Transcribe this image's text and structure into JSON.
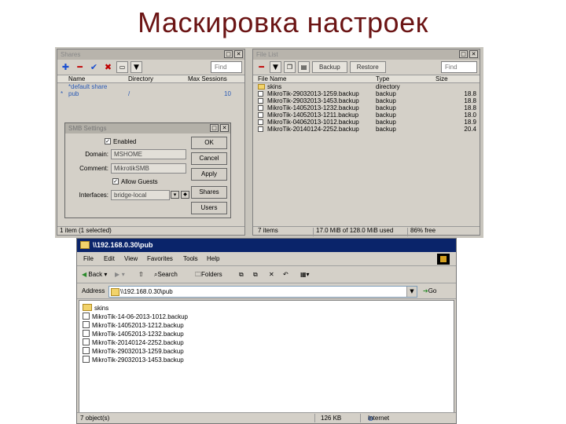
{
  "slide_title": "Маскировка настроек",
  "share_panel": {
    "title": "Shares",
    "find": "Find",
    "columns": [
      "Name",
      "Directory",
      "Max Sessions"
    ],
    "rows": [
      {
        "name": "*default share",
        "directory": "",
        "max_sessions": ""
      },
      {
        "name": "pub",
        "directory": "/",
        "max_sessions": "10"
      }
    ],
    "status": "1 item (1 selected)"
  },
  "smb_dialog": {
    "title": "SMB Settings",
    "enabled_label": "Enabled",
    "domain_label": "Domain:",
    "domain_value": "MSHOME",
    "comment_label": "Comment:",
    "comment_value": "MikrotikSMB",
    "allow_guests_label": "Allow Guests",
    "interfaces_label": "Interfaces:",
    "interfaces_value": "bridge-local",
    "buttons": [
      "OK",
      "Cancel",
      "Apply",
      "Shares",
      "Users"
    ]
  },
  "file_panel": {
    "title": "File List",
    "backup_button": "Backup",
    "restore_button": "Restore",
    "find": "Find",
    "columns": [
      "File Name",
      "Type",
      "Size"
    ],
    "rows": [
      {
        "name": "skins",
        "type": "directory",
        "size": ""
      },
      {
        "name": "MikroTik-29032013-1259.backup",
        "type": "backup",
        "size": "18.8"
      },
      {
        "name": "MikroTik-29032013-1453.backup",
        "type": "backup",
        "size": "18.8"
      },
      {
        "name": "MikroTik-14052013-1232.backup",
        "type": "backup",
        "size": "18.8"
      },
      {
        "name": "MikroTik-14052013-1211.backup",
        "type": "backup",
        "size": "18.0"
      },
      {
        "name": "MikroTik-04062013-1012.backup",
        "type": "backup",
        "size": "18.9"
      },
      {
        "name": "MikroTik-20140124-2252.backup",
        "type": "backup",
        "size": "20.4"
      }
    ],
    "status_items": "7 items",
    "status_used": "17.0 MiB of 128.0 MiB used",
    "status_free": "86% free"
  },
  "explorer": {
    "title": "\\\\192.168.0.30\\pub",
    "menu": [
      "File",
      "Edit",
      "View",
      "Favorites",
      "Tools",
      "Help"
    ],
    "toolbar": {
      "back": "Back",
      "search": "Search",
      "folders": "Folders"
    },
    "address_label": "Address",
    "address_value": "\\\\192.168.0.30\\pub",
    "go": "Go",
    "files": [
      {
        "name": "skins",
        "folder": true
      },
      {
        "name": "MikroTik-14-06-2013-1012.backup",
        "folder": false
      },
      {
        "name": "MikroTik-14052013-1212.backup",
        "folder": false
      },
      {
        "name": "MikroTik-14052013-1232.backup",
        "folder": false
      },
      {
        "name": "MikroTik-20140124-2252.backup",
        "folder": false
      },
      {
        "name": "MikroTik-29032013-1259.backup",
        "folder": false
      },
      {
        "name": "MikroTik-29032013-1453.backup",
        "folder": false
      }
    ],
    "status_objects": "7 object(s)",
    "status_size": "126 KB",
    "status_zone": "Internet"
  }
}
